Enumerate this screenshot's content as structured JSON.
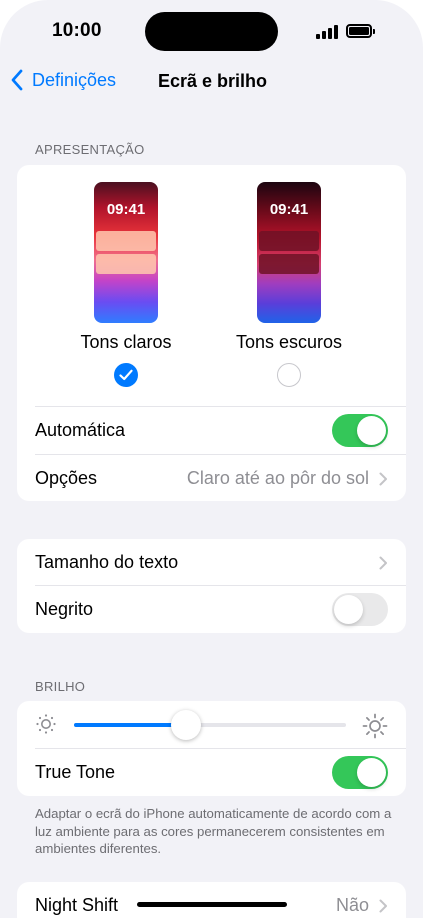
{
  "status_bar": {
    "time": "10:00",
    "signal_icon": "cellular-signal-icon",
    "battery_icon": "battery-full-icon"
  },
  "nav": {
    "back_label": "Definições",
    "title": "Ecrã e brilho"
  },
  "appearance": {
    "section_header": "APRESENTAÇÃO",
    "light": {
      "preview_time": "09:41",
      "label": "Tons claros",
      "selected": true
    },
    "dark": {
      "preview_time": "09:41",
      "label": "Tons escuros",
      "selected": false
    },
    "automatic": {
      "label": "Automática",
      "on": true
    },
    "options": {
      "label": "Opções",
      "value": "Claro até ao pôr do sol"
    }
  },
  "text": {
    "size": {
      "label": "Tamanho do texto"
    },
    "bold": {
      "label": "Negrito",
      "on": false
    }
  },
  "brightness": {
    "section_header": "BRILHO",
    "level": 0.41,
    "true_tone": {
      "label": "True Tone",
      "on": true
    },
    "footnote": "Adaptar o ecrã do iPhone automaticamente de acordo com a luz ambiente para as cores permanecerem consistentes em ambientes diferentes."
  },
  "night_shift": {
    "label": "Night Shift",
    "value": "Não"
  },
  "colors": {
    "accent": "#007aff",
    "toggle_on": "#34c759",
    "toggle_off": "#e9e9ea",
    "background": "#f2f2f7"
  }
}
